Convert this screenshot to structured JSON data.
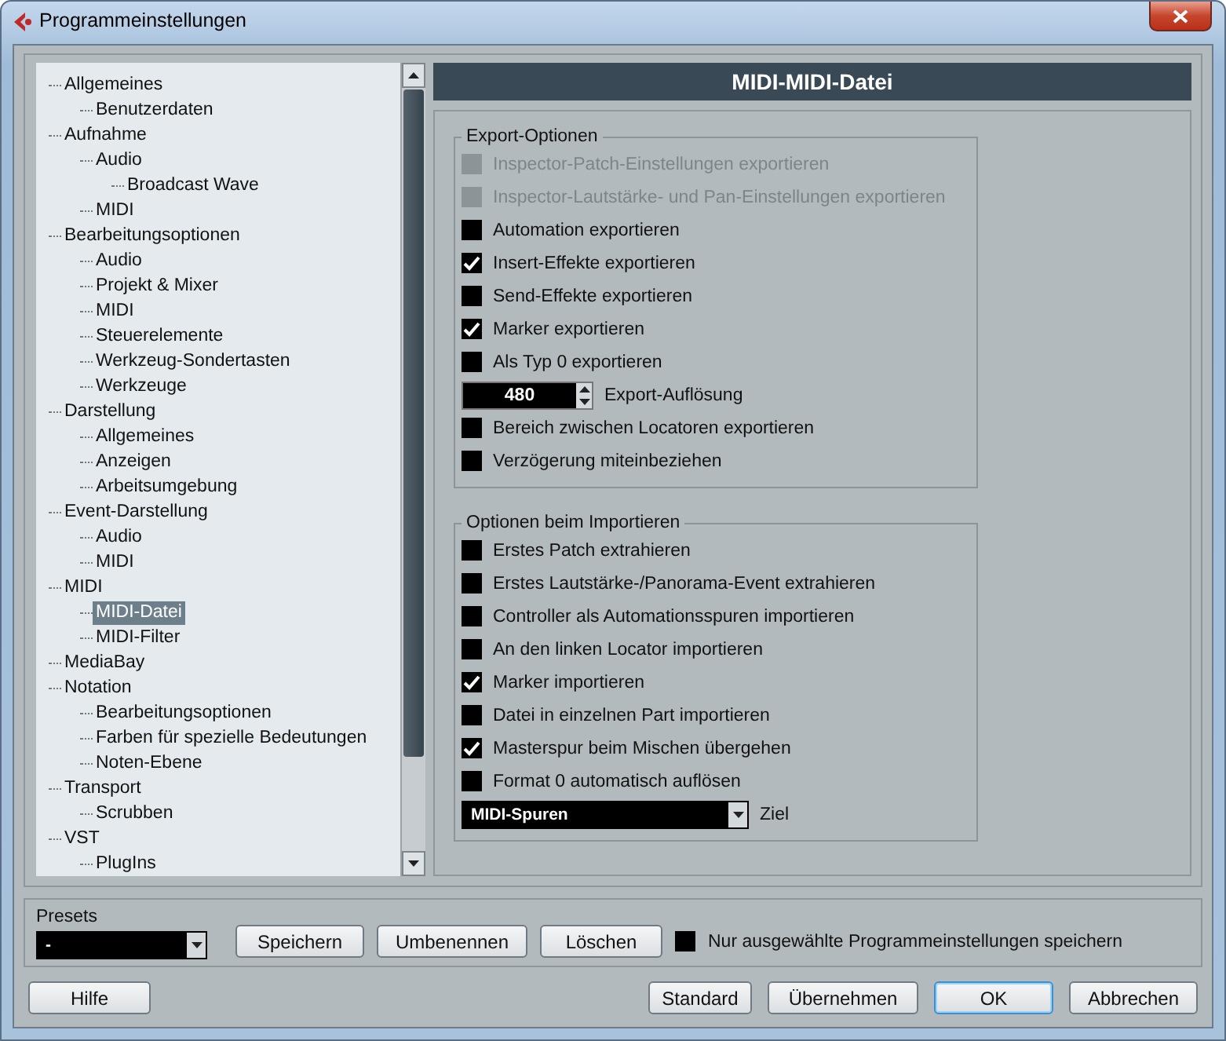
{
  "window": {
    "title": "Programmeinstellungen"
  },
  "tree": [
    {
      "label": "Allgemeines",
      "selected": false,
      "children": [
        {
          "label": "Benutzerdaten",
          "selected": false
        }
      ]
    },
    {
      "label": "Aufnahme",
      "selected": false,
      "children": [
        {
          "label": "Audio",
          "selected": false,
          "children": [
            {
              "label": "Broadcast Wave",
              "selected": false
            }
          ]
        },
        {
          "label": "MIDI",
          "selected": false
        }
      ]
    },
    {
      "label": "Bearbeitungsoptionen",
      "selected": false,
      "children": [
        {
          "label": "Audio",
          "selected": false
        },
        {
          "label": "Projekt & Mixer",
          "selected": false
        },
        {
          "label": "MIDI",
          "selected": false
        },
        {
          "label": "Steuerelemente",
          "selected": false
        },
        {
          "label": "Werkzeug-Sondertasten",
          "selected": false
        },
        {
          "label": "Werkzeuge",
          "selected": false
        }
      ]
    },
    {
      "label": "Darstellung",
      "selected": false,
      "children": [
        {
          "label": "Allgemeines",
          "selected": false
        },
        {
          "label": "Anzeigen",
          "selected": false
        },
        {
          "label": "Arbeitsumgebung",
          "selected": false
        }
      ]
    },
    {
      "label": "Event-Darstellung",
      "selected": false,
      "children": [
        {
          "label": "Audio",
          "selected": false
        },
        {
          "label": "MIDI",
          "selected": false
        }
      ]
    },
    {
      "label": "MIDI",
      "selected": false,
      "children": [
        {
          "label": "MIDI-Datei",
          "selected": true
        },
        {
          "label": "MIDI-Filter",
          "selected": false
        }
      ]
    },
    {
      "label": "MediaBay",
      "selected": false
    },
    {
      "label": "Notation",
      "selected": false,
      "children": [
        {
          "label": "Bearbeitungsoptionen",
          "selected": false
        },
        {
          "label": "Farben für spezielle Bedeutungen",
          "selected": false
        },
        {
          "label": "Noten-Ebene",
          "selected": false
        }
      ]
    },
    {
      "label": "Transport",
      "selected": false,
      "children": [
        {
          "label": "Scrubben",
          "selected": false
        }
      ]
    },
    {
      "label": "VST",
      "selected": false,
      "children": [
        {
          "label": "PlugIns",
          "selected": false
        }
      ]
    }
  ],
  "page_title": "MIDI-MIDI-Datei",
  "groups": [
    {
      "title": "Export-Optionen",
      "options": [
        {
          "kind": "checkbox",
          "label": "Inspector-Patch-Einstellungen exportieren",
          "checked": false,
          "disabled": true
        },
        {
          "kind": "checkbox",
          "label": "Inspector-Lautstärke- und Pan-Einstellungen exportieren",
          "checked": false,
          "disabled": true
        },
        {
          "kind": "checkbox",
          "label": "Automation exportieren",
          "checked": false,
          "disabled": false
        },
        {
          "kind": "checkbox",
          "label": "Insert-Effekte exportieren",
          "checked": true,
          "disabled": false
        },
        {
          "kind": "checkbox",
          "label": "Send-Effekte exportieren",
          "checked": false,
          "disabled": false
        },
        {
          "kind": "checkbox",
          "label": "Marker exportieren",
          "checked": true,
          "disabled": false
        },
        {
          "kind": "checkbox",
          "label": "Als Typ 0 exportieren",
          "checked": false,
          "disabled": false
        },
        {
          "kind": "spinner",
          "value": "480",
          "caption_right": "Export-Auflösung"
        },
        {
          "kind": "checkbox",
          "label": "Bereich zwischen Locatoren exportieren",
          "checked": false,
          "disabled": false
        },
        {
          "kind": "checkbox",
          "label": "Verzögerung miteinbeziehen",
          "checked": false,
          "disabled": false
        }
      ]
    },
    {
      "title": "Optionen beim Importieren",
      "options": [
        {
          "kind": "checkbox",
          "label": "Erstes Patch extrahieren",
          "checked": false,
          "disabled": false
        },
        {
          "kind": "checkbox",
          "label": "Erstes Lautstärke-/Panorama-Event extrahieren",
          "checked": false,
          "disabled": false
        },
        {
          "kind": "checkbox",
          "label": "Controller als Automationsspuren importieren",
          "checked": false,
          "disabled": false
        },
        {
          "kind": "checkbox",
          "label": "An den linken Locator importieren",
          "checked": false,
          "disabled": false
        },
        {
          "kind": "checkbox",
          "label": "Marker importieren",
          "checked": true,
          "disabled": false
        },
        {
          "kind": "checkbox",
          "label": "Datei in einzelnen Part importieren",
          "checked": false,
          "disabled": false
        },
        {
          "kind": "checkbox",
          "label": "Masterspur beim Mischen übergehen",
          "checked": true,
          "disabled": false
        },
        {
          "kind": "checkbox",
          "label": "Format 0 automatisch auflösen",
          "checked": false,
          "disabled": false
        },
        {
          "kind": "dropdown",
          "value": "MIDI-Spuren",
          "caption_right": "Ziel"
        }
      ]
    }
  ],
  "presets": {
    "label": "Presets",
    "value": "-",
    "buttons": [
      "Speichern",
      "Umbenennen",
      "Löschen"
    ],
    "only_selected": {
      "label": "Nur ausgewählte Programmeinstellungen speichern",
      "checked": false
    }
  },
  "footer_buttons": [
    {
      "label": "Hilfe",
      "default": false
    },
    {
      "label": "Standard",
      "default": false
    },
    {
      "label": "Übernehmen",
      "default": false
    },
    {
      "label": "OK",
      "default": true
    },
    {
      "label": "Abbrechen",
      "default": false
    }
  ]
}
